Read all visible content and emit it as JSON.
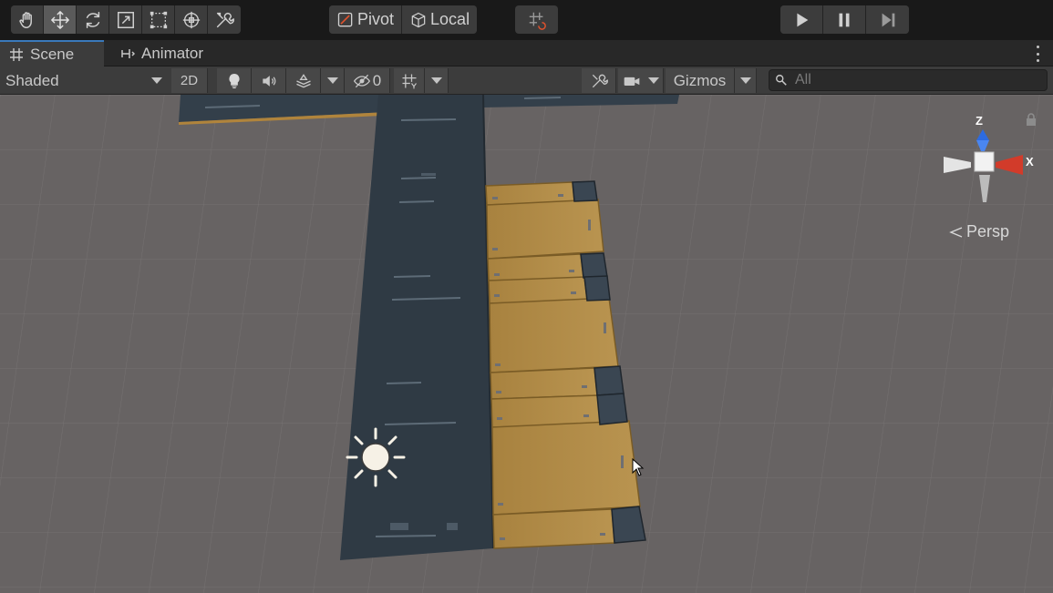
{
  "toolbar": {
    "tools": [
      {
        "name": "hand-tool",
        "icon": "hand-icon"
      },
      {
        "name": "move-tool",
        "icon": "move-icon",
        "active": true
      },
      {
        "name": "rotate-tool",
        "icon": "rotate-icon"
      },
      {
        "name": "scale-tool",
        "icon": "scale-icon"
      },
      {
        "name": "rect-tool",
        "icon": "rect-transform-icon"
      },
      {
        "name": "transform-tool",
        "icon": "transform-icon"
      },
      {
        "name": "custom-tool",
        "icon": "tools-icon"
      }
    ],
    "pivot_label": "Pivot",
    "local_label": "Local",
    "snap_icon": "grid-snap-icon",
    "play_icons": [
      "play-icon",
      "pause-icon",
      "step-icon"
    ]
  },
  "tabs": [
    {
      "label": "Scene",
      "icon": "hash-grid-icon",
      "active": true
    },
    {
      "label": "Animator",
      "icon": "animator-icon",
      "active": false
    }
  ],
  "scene_toolbar": {
    "shading_mode": "Shaded",
    "mode_2d": "2D",
    "hidden_count": "0",
    "gizmos_label": "Gizmos",
    "search_placeholder": "All"
  },
  "gizmo": {
    "axis_y": "Z",
    "axis_x": "X",
    "projection": "Persp"
  },
  "colors": {
    "accent": "#3a79bb",
    "ground": "#676363",
    "floor_dark": "#2f3a44",
    "plank": "#b18a4a",
    "axis_x": "#d23b2a",
    "axis_z": "#2d6be0"
  }
}
